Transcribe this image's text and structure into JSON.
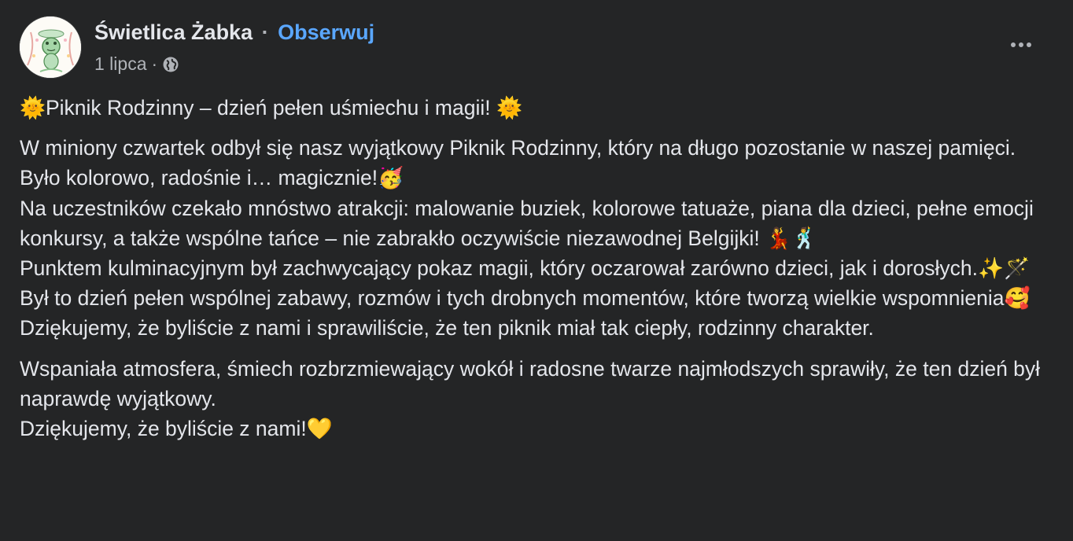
{
  "page": {
    "name": "Świetlica Żabka",
    "separator": "·",
    "follow_label": "Obserwuj",
    "date": "1 lipca",
    "meta_separator": "·",
    "privacy_icon": "globe-icon",
    "more_icon": "more-options-icon"
  },
  "post": {
    "paragraph1": "🌞Piknik Rodzinny – dzień pełen uśmiechu i magii! 🌞",
    "paragraph2_lines": [
      "W miniony czwartek odbył się nasz wyjątkowy Piknik Rodzinny, który na długo pozostanie w naszej pamięci. Było kolorowo, radośnie i… magicznie!🥳",
      "Na uczestników czekało mnóstwo atrakcji: malowanie buziek, kolorowe tatuaże, piana dla dzieci, pełne emocji konkursy, a także wspólne tańce – nie zabrakło oczywiście niezawodnej Belgijki! 💃🕺",
      "Punktem kulminacyjnym był zachwycający pokaz magii, który oczarował zarówno dzieci, jak i dorosłych.✨🪄",
      "Był to dzień pełen wspólnej zabawy, rozmów i tych drobnych momentów, które tworzą wielkie wspomnienia🥰 Dziękujemy, że byliście z nami i sprawiliście, że ten piknik miał tak ciepły, rodzinny charakter."
    ],
    "paragraph3_lines": [
      "Wspaniała atmosfera, śmiech rozbrzmiewający wokół i radosne twarze najmłodszych sprawiły, że ten dzień był naprawdę wyjątkowy.",
      "Dziękujemy, że byliście z nami!💛"
    ]
  },
  "colors": {
    "background": "#242526",
    "text": "#e4e6eb",
    "secondary_text": "#b0b3b8",
    "link": "#5aa7ff"
  }
}
